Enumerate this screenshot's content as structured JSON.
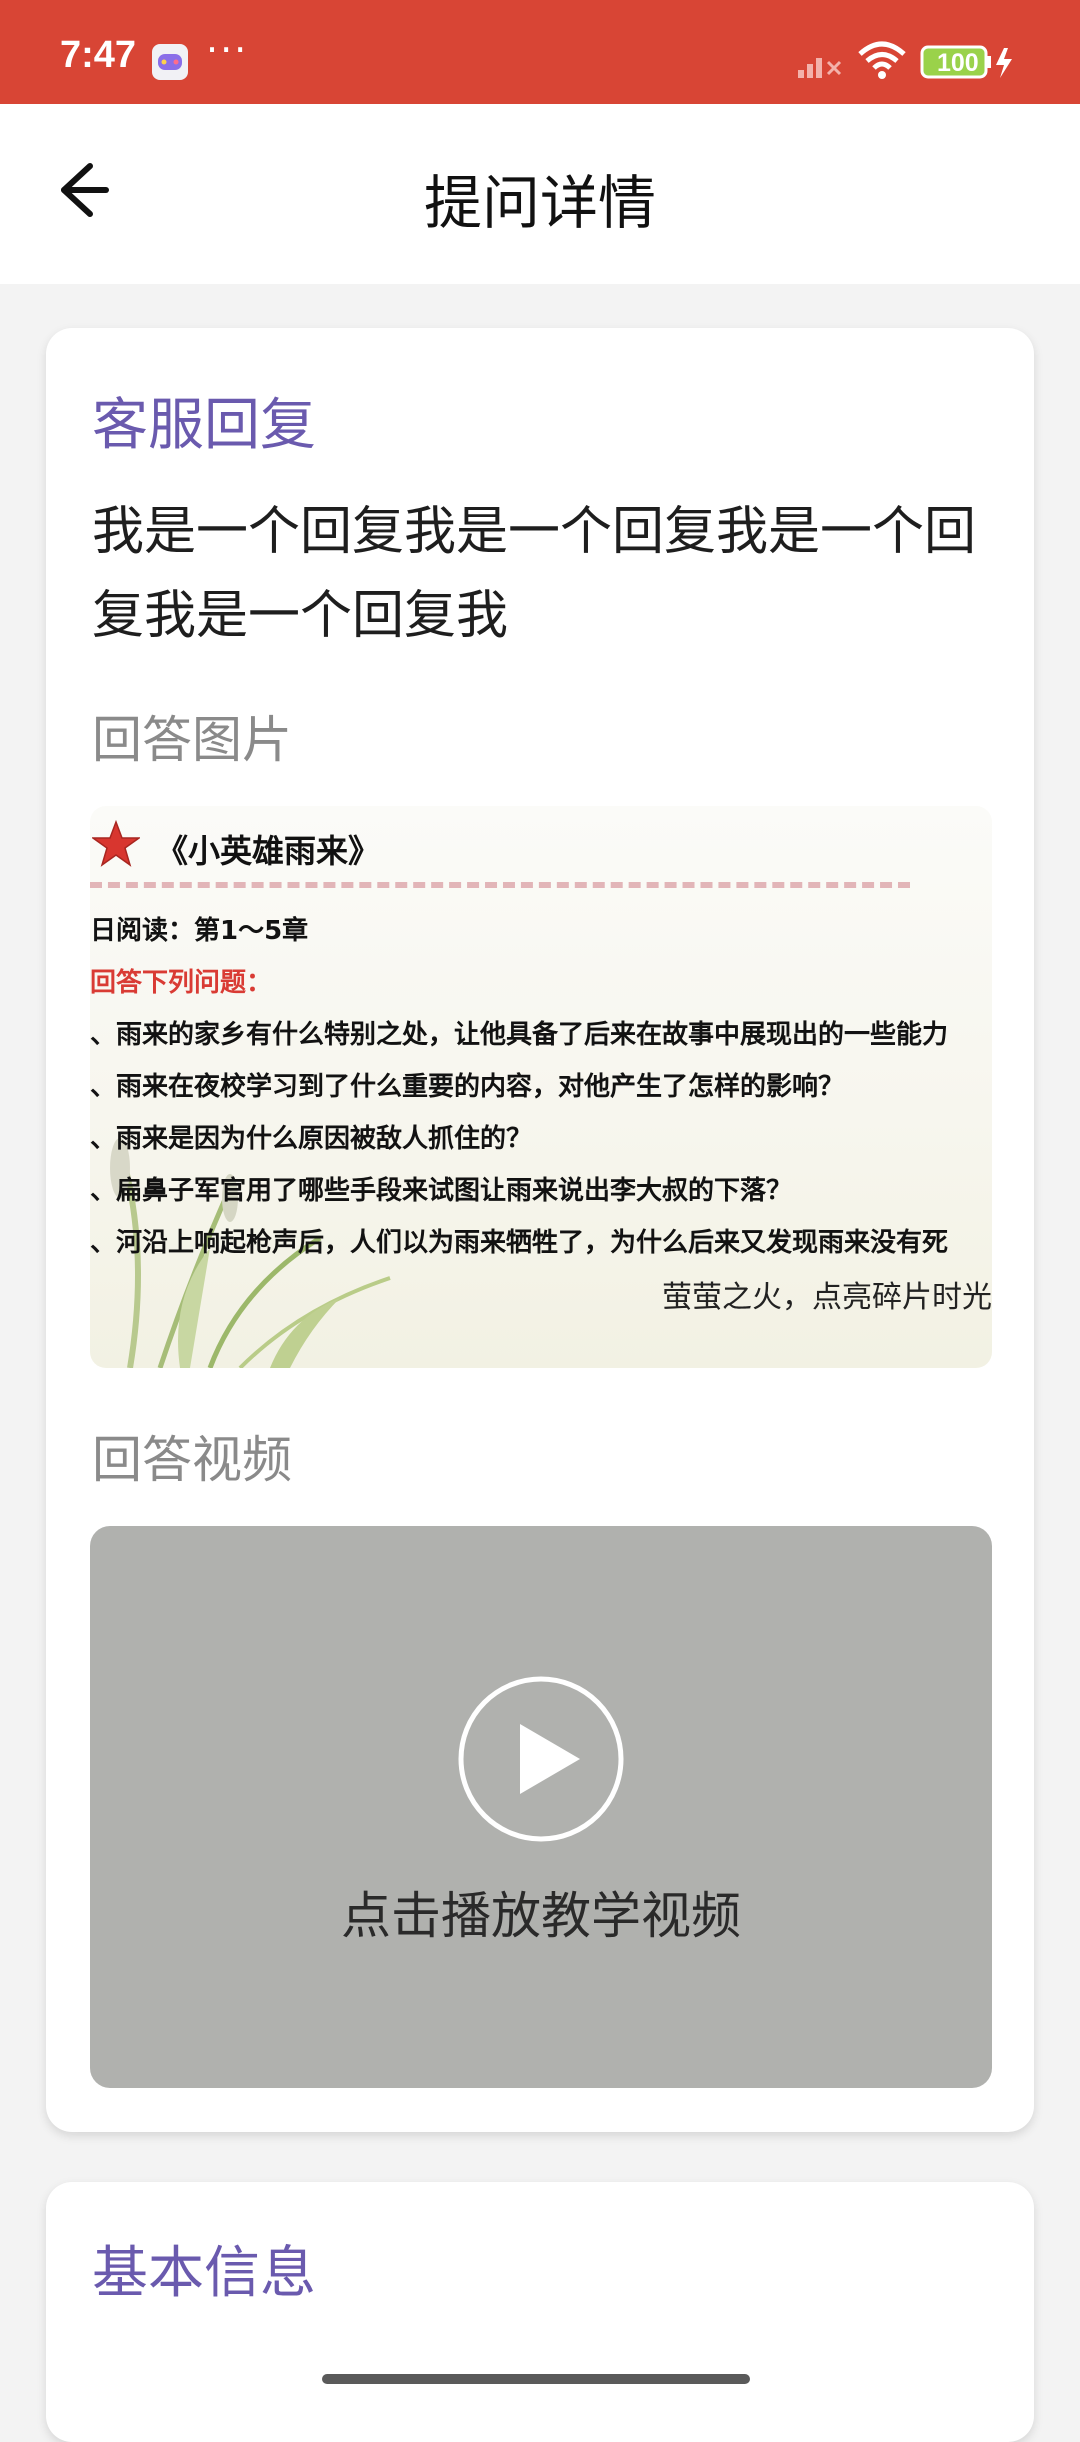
{
  "status_bar": {
    "time": "7:47",
    "dots": "···",
    "battery": "100"
  },
  "header": {
    "title": "提问详情"
  },
  "reply_card": {
    "section_title": "客服回复",
    "reply_text": "我是一个回复我是一个回复我是一个回复我是一个回复我",
    "image_label": "回答图片",
    "image": {
      "title": "《小英雄雨来》",
      "reading": "日阅读：第1～5章",
      "prompt": "回答下列问题：",
      "questions": [
        "、雨来的家乡有什么特别之处，让他具备了后来在故事中展现出的一些能力",
        "、雨来在夜校学习到了什么重要的内容，对他产生了怎样的影响？",
        "、雨来是因为什么原因被敌人抓住的？",
        "、扁鼻子军官用了哪些手段来试图让雨来说出李大叔的下落？",
        "、河沿上响起枪声后，人们以为雨来牺牲了，为什么后来又发现雨来没有死"
      ],
      "signature": "萤萤之火，点亮碎片时光"
    },
    "video_label": "回答视频",
    "video_caption": "点击播放教学视频"
  },
  "info_card": {
    "section_title": "基本信息"
  },
  "colors": {
    "status_bar": "#d84535",
    "accent": "#6a5aae",
    "video_bg": "#b0b1ae"
  }
}
